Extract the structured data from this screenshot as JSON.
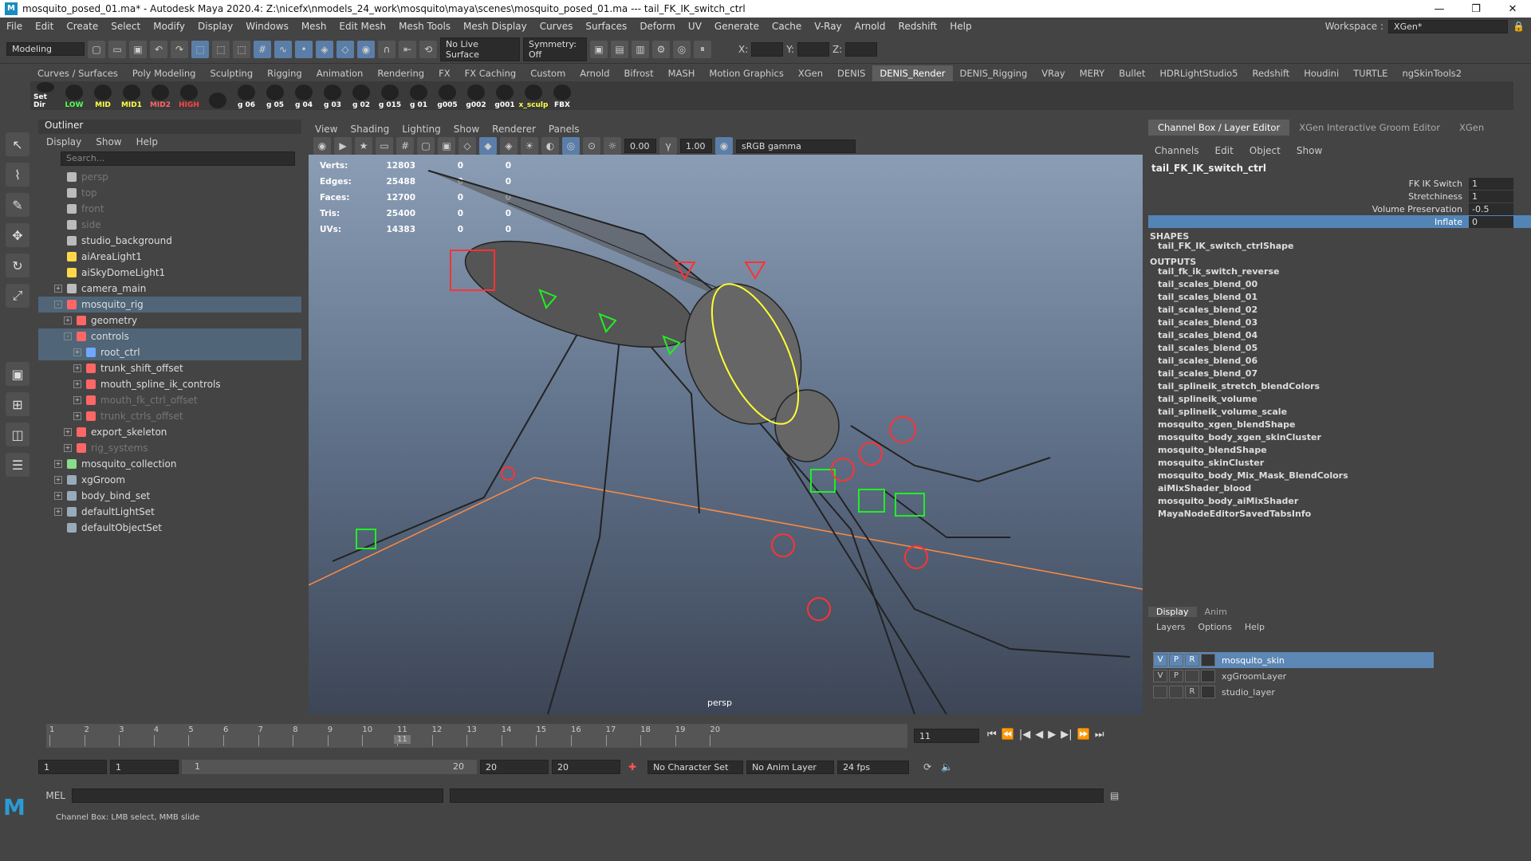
{
  "window": {
    "title": "mosquito_posed_01.ma* - Autodesk Maya 2020.4: Z:\\nicefx\\nmodels_24_work\\mosquito\\maya\\scenes\\mosquito_posed_01.ma   ---   tail_FK_IK_switch_ctrl",
    "minimize": "—",
    "restore": "❐",
    "close": "✕"
  },
  "menubar": {
    "items": [
      "File",
      "Edit",
      "Create",
      "Select",
      "Modify",
      "Display",
      "Windows",
      "Mesh",
      "Edit Mesh",
      "Mesh Tools",
      "Mesh Display",
      "Curves",
      "Surfaces",
      "Deform",
      "UV",
      "Generate",
      "Cache",
      "V-Ray",
      "Arnold",
      "Redshift",
      "Help"
    ],
    "workspace_label": "Workspace :",
    "workspace_value": "XGen*"
  },
  "statusline": {
    "mode": "Modeling",
    "live_surface": "No Live Surface",
    "symmetry": "Symmetry: Off",
    "x_label": "X:",
    "y_label": "Y:",
    "z_label": "Z:"
  },
  "shelf_tabs": [
    "Curves / Surfaces",
    "Poly Modeling",
    "Sculpting",
    "Rigging",
    "Animation",
    "Rendering",
    "FX",
    "FX Caching",
    "Custom",
    "Arnold",
    "Bifrost",
    "MASH",
    "Motion Graphics",
    "XGen",
    "DENIS",
    "DENIS_Render",
    "DENIS_Rigging",
    "VRay",
    "MERY",
    "Bullet",
    "HDRLightStudio5",
    "Redshift",
    "Houdini",
    "TURTLE",
    "ngSkinTools2"
  ],
  "shelf_active": "DENIS_Render",
  "shelf_buttons": [
    {
      "label": "Set Dir",
      "color": "#ffffff"
    },
    {
      "label": "LOW",
      "color": "#55ff55"
    },
    {
      "label": "MID",
      "color": "#ffff44"
    },
    {
      "label": "MID1",
      "color": "#ffff44"
    },
    {
      "label": "MID2",
      "color": "#ff6666"
    },
    {
      "label": "HIGH",
      "color": "#ff4444"
    },
    {
      "label": "",
      "color": "#ffffff"
    },
    {
      "label": "g 06",
      "color": "#ffffff"
    },
    {
      "label": "g 05",
      "color": "#ffffff"
    },
    {
      "label": "g 04",
      "color": "#ffffff"
    },
    {
      "label": "g 03",
      "color": "#ffffff"
    },
    {
      "label": "g 02",
      "color": "#ffffff"
    },
    {
      "label": "g 015",
      "color": "#ffffff"
    },
    {
      "label": "g 01",
      "color": "#ffffff"
    },
    {
      "label": "g005",
      "color": "#ffffff"
    },
    {
      "label": "g002",
      "color": "#ffffff"
    },
    {
      "label": "g001",
      "color": "#ffffff"
    },
    {
      "label": "x_sculp",
      "color": "#ffff44"
    },
    {
      "label": "FBX",
      "color": "#ffffff"
    }
  ],
  "outliner": {
    "title": "Outliner",
    "menu": [
      "Display",
      "Show",
      "Help"
    ],
    "search_placeholder": "Search...",
    "items": [
      {
        "label": "persp",
        "indent": 0,
        "dim": true,
        "icon": "camera-icon"
      },
      {
        "label": "top",
        "indent": 0,
        "dim": true,
        "icon": "camera-icon"
      },
      {
        "label": "front",
        "indent": 0,
        "dim": true,
        "icon": "camera-icon"
      },
      {
        "label": "side",
        "indent": 0,
        "dim": true,
        "icon": "camera-icon"
      },
      {
        "label": "studio_background",
        "indent": 0,
        "icon": "mesh-icon"
      },
      {
        "label": "aiAreaLight1",
        "indent": 0,
        "icon": "light-icon"
      },
      {
        "label": "aiSkyDomeLight1",
        "indent": 0,
        "icon": "skydome-icon"
      },
      {
        "label": "camera_main",
        "indent": 0,
        "expand": "+",
        "icon": "camera-icon"
      },
      {
        "label": "mosquito_rig",
        "indent": 0,
        "expand": "-",
        "icon": "rig-icon",
        "sel": true
      },
      {
        "label": "geometry",
        "indent": 1,
        "expand": "+",
        "icon": "rig-icon"
      },
      {
        "label": "controls",
        "indent": 1,
        "expand": "-",
        "icon": "rig-icon",
        "sel": true
      },
      {
        "label": "root_ctrl",
        "indent": 2,
        "expand": "+",
        "icon": "curve-icon",
        "sel": true
      },
      {
        "label": "trunk_shift_offset",
        "indent": 2,
        "expand": "+",
        "icon": "rig-icon"
      },
      {
        "label": "mouth_spline_ik_controls",
        "indent": 2,
        "expand": "+",
        "icon": "rig-icon"
      },
      {
        "label": "mouth_fk_ctrl_offset",
        "indent": 2,
        "expand": "+",
        "icon": "rig-icon",
        "dim": true
      },
      {
        "label": "trunk_ctrls_offset",
        "indent": 2,
        "expand": "+",
        "icon": "rig-icon",
        "dim": true
      },
      {
        "label": "export_skeleton",
        "indent": 1,
        "expand": "+",
        "icon": "rig-icon"
      },
      {
        "label": "rig_systems",
        "indent": 1,
        "expand": "+",
        "icon": "rig-icon",
        "dim": true
      },
      {
        "label": "mosquito_collection",
        "indent": 0,
        "expand": "+",
        "icon": "collection-icon"
      },
      {
        "label": "xgGroom",
        "indent": 0,
        "expand": "+",
        "icon": "set-icon"
      },
      {
        "label": "body_bind_set",
        "indent": 0,
        "expand": "+",
        "icon": "set-icon"
      },
      {
        "label": "defaultLightSet",
        "indent": 0,
        "expand": "+",
        "icon": "set-icon"
      },
      {
        "label": "defaultObjectSet",
        "indent": 0,
        "icon": "set-icon"
      }
    ]
  },
  "viewport": {
    "menu": [
      "View",
      "Shading",
      "Lighting",
      "Show",
      "Renderer",
      "Panels"
    ],
    "near": "0.00",
    "far": "1.00",
    "color_space": "sRGB gamma",
    "camera": "persp",
    "hud": [
      {
        "k": "Verts:",
        "v": "12803",
        "a": "0",
        "b": "0"
      },
      {
        "k": "Edges:",
        "v": "25488",
        "a": "0",
        "b": "0"
      },
      {
        "k": "Faces:",
        "v": "12700",
        "a": "0",
        "b": "0"
      },
      {
        "k": "Tris:",
        "v": "25400",
        "a": "0",
        "b": "0"
      },
      {
        "k": "UVs:",
        "v": "14383",
        "a": "0",
        "b": "0"
      }
    ]
  },
  "channelbox": {
    "tabs": [
      "Channel Box / Layer Editor",
      "XGen Interactive Groom Editor",
      "XGen"
    ],
    "menu": [
      "Channels",
      "Edit",
      "Object",
      "Show"
    ],
    "node": "tail_FK_IK_switch_ctrl",
    "attrs": [
      {
        "n": "FK IK Switch",
        "v": "1"
      },
      {
        "n": "Stretchiness",
        "v": "1"
      },
      {
        "n": "Volume Preservation",
        "v": "-0.5"
      },
      {
        "n": "Inflate",
        "v": "0",
        "sel": true
      }
    ],
    "shapes_label": "SHAPES",
    "shapes": [
      "tail_FK_IK_switch_ctrlShape"
    ],
    "outputs_label": "OUTPUTS",
    "outputs": [
      "tail_fk_ik_switch_reverse",
      "tail_scales_blend_00",
      "tail_scales_blend_01",
      "tail_scales_blend_02",
      "tail_scales_blend_03",
      "tail_scales_blend_04",
      "tail_scales_blend_05",
      "tail_scales_blend_06",
      "tail_scales_blend_07",
      "tail_splineik_stretch_blendColors",
      "tail_splineik_volume",
      "tail_splineik_volume_scale",
      "mosquito_xgen_blendShape",
      "mosquito_body_xgen_skinCluster",
      "mosquito_blendShape",
      "mosquito_skinCluster",
      "mosquito_body_Mix_Mask_BlendColors",
      "aiMixShader_blood",
      "mosquito_body_aiMixShader",
      "MayaNodeEditorSavedTabsInfo"
    ]
  },
  "layers": {
    "tabs": [
      "Display",
      "Anim"
    ],
    "menu": [
      "Layers",
      "Options",
      "Help"
    ],
    "items": [
      {
        "v": "V",
        "p": "P",
        "r": "R",
        "name": "mosquito_skin",
        "sel": true
      },
      {
        "v": "V",
        "p": "P",
        "r": "",
        "name": "xgGroomLayer"
      },
      {
        "v": "",
        "p": "",
        "r": "R",
        "name": "studio_layer"
      }
    ]
  },
  "timeline": {
    "ticks": [
      "1",
      "2",
      "3",
      "4",
      "5",
      "6",
      "7",
      "8",
      "9",
      "10",
      "11",
      "12",
      "13",
      "14",
      "15",
      "16",
      "17",
      "18",
      "19",
      "20"
    ],
    "current": "11",
    "current_field": "11"
  },
  "range": {
    "start": "1",
    "anim_start": "1",
    "slider_start": "1",
    "slider_end": "20",
    "end": "20",
    "anim_end": "20",
    "character": "No Character Set",
    "anim_layer": "No Anim Layer",
    "fps": "24 fps"
  },
  "cmd": {
    "lang": "MEL"
  },
  "help": {
    "text": "Channel Box: LMB select, MMB slide"
  }
}
